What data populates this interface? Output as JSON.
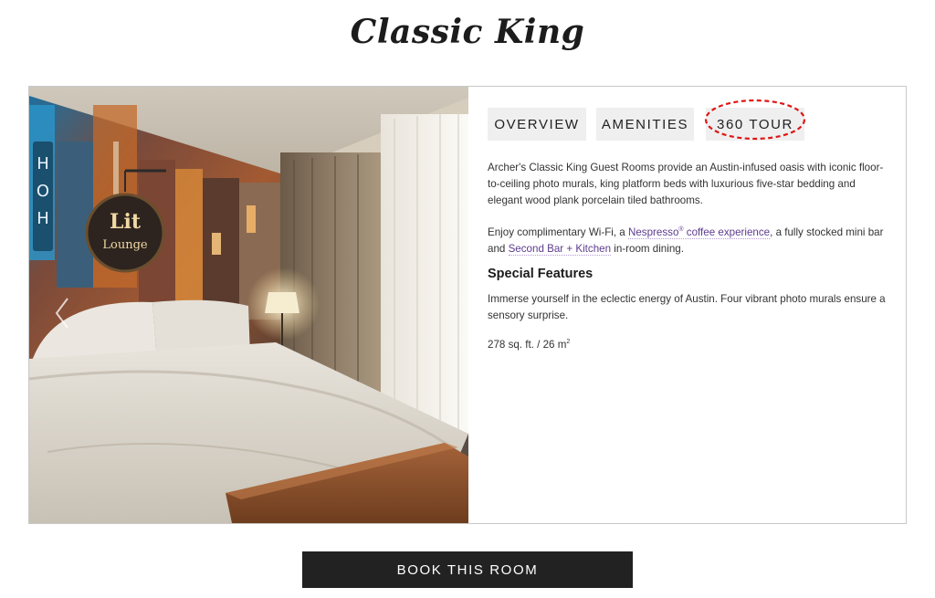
{
  "page": {
    "title": "Classic King"
  },
  "room_image": {
    "sign_line1": "Lit",
    "sign_line2": "Lounge",
    "neon_letters": "HOH"
  },
  "tabs": [
    {
      "label": "OVERVIEW"
    },
    {
      "label": "AMENITIES"
    },
    {
      "label": "360 TOUR"
    }
  ],
  "overview": {
    "paragraph1": "Archer's Classic King Guest Rooms provide an Austin-infused oasis with iconic floor-to-ceiling photo murals, king platform beds with luxurious five-star bedding and elegant wood plank porcelain tiled bathrooms.",
    "p2_before": "Enjoy complimentary Wi-Fi, a ",
    "p2_link1": "Nespresso",
    "p2_link1_sup": "®",
    "p2_link1_rest": " coffee experience",
    "p2_middle": ", a fully stocked mini bar and ",
    "p2_link2": "Second Bar + Kitchen",
    "p2_after": " in-room dining.",
    "features_heading": "Special Features",
    "features_text": "Immerse yourself in the eclectic energy of Austin. Four vibrant photo murals ensure a sensory surprise.",
    "size_text": "278 sq. ft. / 26 m",
    "size_sup": "2"
  },
  "actions": {
    "book_label": "BOOK THIS ROOM"
  },
  "colors": {
    "link": "#5d3c8e",
    "highlight": "#e01515",
    "button_bg": "#222222",
    "tab_bg": "#efefef"
  }
}
